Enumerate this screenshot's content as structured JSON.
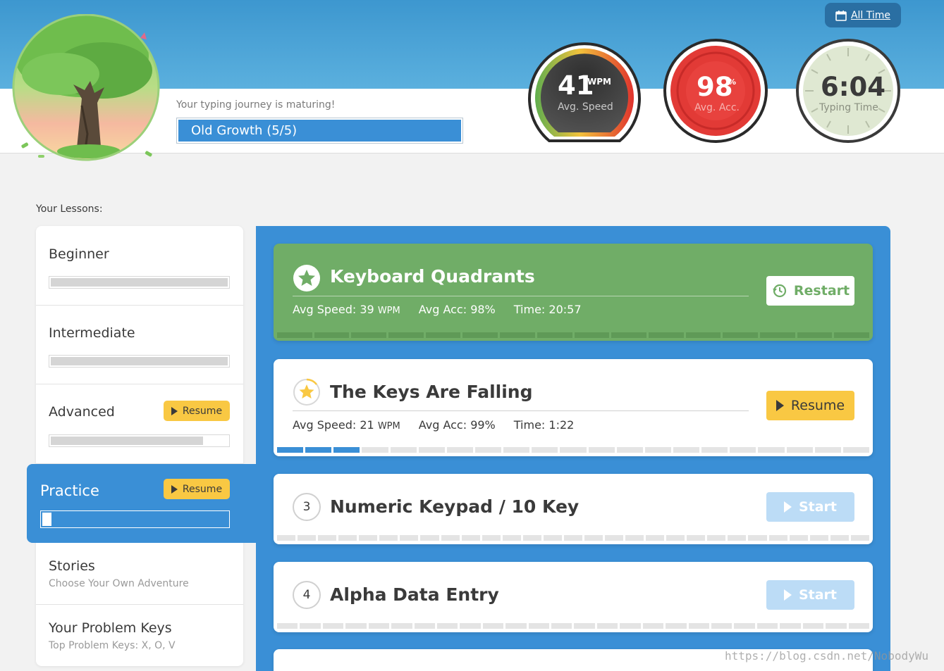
{
  "header": {
    "all_time": "All Time",
    "journey_text": "Your typing journey is maturing!",
    "level": "Old Growth (5/5)"
  },
  "stats": {
    "speed": {
      "value": "41",
      "unit": "WPM",
      "label": "Avg. Speed"
    },
    "accuracy": {
      "value": "98",
      "unit": "%",
      "label": "Avg. Acc."
    },
    "time": {
      "value": "6:04",
      "label": "Typing Time"
    }
  },
  "lessons": {
    "heading": "Your Lessons:",
    "items": [
      {
        "title": "Beginner",
        "progress": 1.0
      },
      {
        "title": "Intermediate",
        "progress": 1.0
      },
      {
        "title": "Advanced",
        "progress": 0.86,
        "action": "Resume"
      },
      {
        "title": "Practice",
        "progress": 0.05,
        "action": "Resume"
      },
      {
        "title": "Stories",
        "subtitle": "Choose Your Own Adventure"
      },
      {
        "title": "Your Problem Keys",
        "subtitle": "Top Problem Keys: X, O, V"
      }
    ]
  },
  "cards": [
    {
      "title": "Keyboard Quadrants",
      "speed_label": "Avg Speed: 39",
      "speed_unit": "WPM",
      "acc": "Avg Acc: 98%",
      "time": "Time: 20:57",
      "button": "Restart",
      "segments_total": 16,
      "segments_done": 16
    },
    {
      "title": "The Keys Are Falling",
      "speed_label": "Avg Speed: 21",
      "speed_unit": "WPM",
      "acc": "Avg Acc: 99%",
      "time": "Time: 1:22",
      "button": "Resume",
      "segments_total": 21,
      "segments_done": 3
    },
    {
      "number": "3",
      "title": "Numeric Keypad / 10 Key",
      "button": "Start",
      "segments_total": 29
    },
    {
      "number": "4",
      "title": "Alpha Data Entry",
      "button": "Start",
      "segments_total": 26
    }
  ],
  "watermark": "https://blog.csdn.net/NobodyWu",
  "colors": {
    "header_blue": "#3d97cf",
    "panel_blue": "#3a8fd6",
    "complete_green": "#70ad67",
    "resume_yellow": "#f9c843",
    "accuracy_red": "#d8282e"
  }
}
